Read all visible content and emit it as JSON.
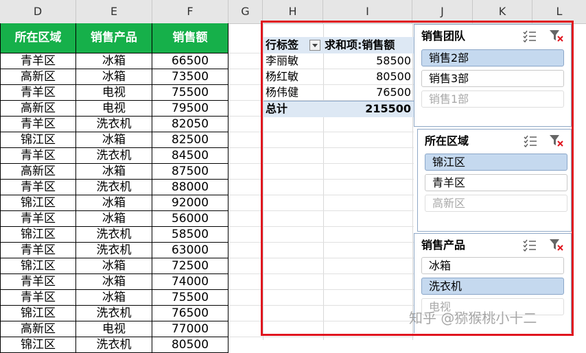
{
  "columns": [
    "D",
    "E",
    "F",
    "G",
    "H",
    "I",
    "J",
    "K",
    "L"
  ],
  "table": {
    "headers": [
      "所在区域",
      "销售产品",
      "销售额"
    ],
    "rows": [
      [
        "青羊区",
        "冰箱",
        "66500"
      ],
      [
        "高新区",
        "冰箱",
        "73500"
      ],
      [
        "青羊区",
        "电视",
        "75500"
      ],
      [
        "高新区",
        "电视",
        "79500"
      ],
      [
        "青羊区",
        "洗衣机",
        "82050"
      ],
      [
        "锦江区",
        "冰箱",
        "82500"
      ],
      [
        "青羊区",
        "洗衣机",
        "84500"
      ],
      [
        "高新区",
        "冰箱",
        "87500"
      ],
      [
        "青羊区",
        "洗衣机",
        "88000"
      ],
      [
        "锦江区",
        "冰箱",
        "92000"
      ],
      [
        "青羊区",
        "冰箱",
        "56000"
      ],
      [
        "锦江区",
        "洗衣机",
        "58500"
      ],
      [
        "青羊区",
        "洗衣机",
        "63000"
      ],
      [
        "锦江区",
        "冰箱",
        "72500"
      ],
      [
        "青羊区",
        "冰箱",
        "74000"
      ],
      [
        "青羊区",
        "冰箱",
        "75500"
      ],
      [
        "锦江区",
        "洗衣机",
        "76500"
      ],
      [
        "高新区",
        "电视",
        "77000"
      ],
      [
        "锦江区",
        "洗衣机",
        "80500"
      ]
    ]
  },
  "pivot": {
    "row_label": "行标签",
    "value_label": "求和项:销售额",
    "rows": [
      {
        "name": "李丽敏",
        "value": "58500"
      },
      {
        "name": "杨红敏",
        "value": "80500"
      },
      {
        "name": "杨伟健",
        "value": "76500"
      }
    ],
    "total_label": "总计",
    "total_value": "215500"
  },
  "slicers": [
    {
      "title": "销售团队",
      "items": [
        {
          "label": "销售2部",
          "state": "selected"
        },
        {
          "label": "销售3部",
          "state": "normal"
        },
        {
          "label": "销售1部",
          "state": "disabled"
        }
      ]
    },
    {
      "title": "所在区域",
      "items": [
        {
          "label": "锦江区",
          "state": "selected"
        },
        {
          "label": "青羊区",
          "state": "normal"
        },
        {
          "label": "高新区",
          "state": "disabled"
        }
      ]
    },
    {
      "title": "销售产品",
      "items": [
        {
          "label": "冰箱",
          "state": "normal"
        },
        {
          "label": "洗衣机",
          "state": "selected"
        },
        {
          "label": "电视",
          "state": "disabled"
        }
      ]
    }
  ],
  "icons": {
    "multiselect": "multi-select-icon",
    "clear": "clear-filter-icon"
  },
  "colors": {
    "header_green": "#16b04a",
    "highlight_border": "#e0141e",
    "selected_item": "#c5d9ef",
    "pivot_band": "#dde8f4"
  },
  "watermark": "知乎 @猕猴桃小十二"
}
